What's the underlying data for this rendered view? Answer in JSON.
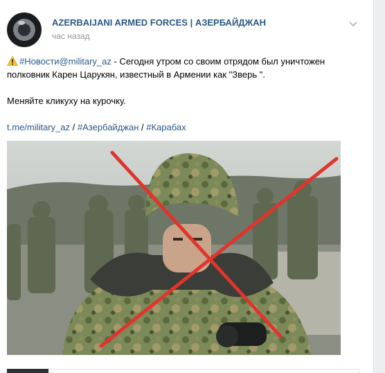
{
  "post": {
    "author": "AZERBAIJANI ARMED FORCES | АЗЕРБАЙДЖАН",
    "time": "час назад",
    "tag_news": "#Новости@military_az",
    "text_main": " - Сегодня утром со своим отрядом был уничтожен полковник Карен Царукян, известный в Армении как \"Зверь \".",
    "text_second": "Меняйте кликуху на курочку.",
    "link_channel": "t.me/military_az",
    "separator": " / ",
    "tag_azerbaijan": "#Азербайджан",
    "tag_karabakh": "#Карабах"
  },
  "icons": {
    "warning": "warning-sign-icon",
    "menu": "chevron-down-icon"
  },
  "colors": {
    "link": "#2a5885",
    "cross": "#e0342c",
    "background": "#edeef0"
  }
}
